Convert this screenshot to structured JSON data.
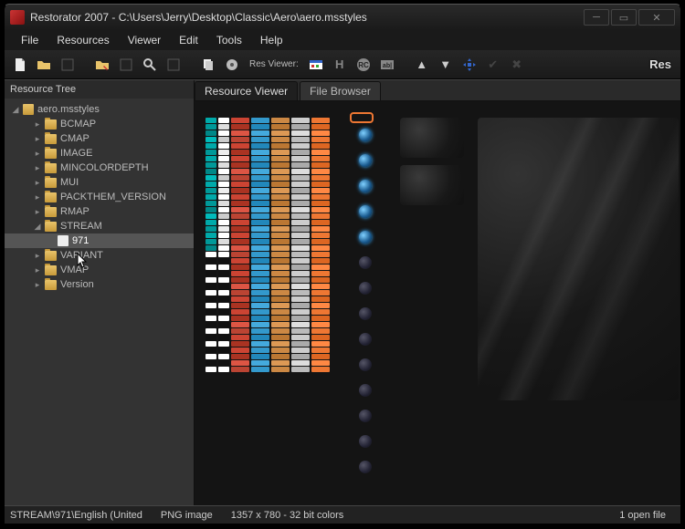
{
  "window": {
    "title": "Restorator 2007 - C:\\Users\\Jerry\\Desktop\\Classic\\Aero\\aero.msstyles"
  },
  "menu": [
    "File",
    "Resources",
    "Viewer",
    "Edit",
    "Tools",
    "Help"
  ],
  "toolbar": {
    "res_viewer_label": "Res Viewer:",
    "logo_top": "Res"
  },
  "sidebar": {
    "header": "Resource Tree",
    "root": "aero.msstyles",
    "items": [
      {
        "label": "BCMAP",
        "expandable": true
      },
      {
        "label": "CMAP",
        "expandable": true
      },
      {
        "label": "IMAGE",
        "expandable": true
      },
      {
        "label": "MINCOLORDEPTH",
        "expandable": true
      },
      {
        "label": "MUI",
        "expandable": true
      },
      {
        "label": "PACKTHEM_VERSION",
        "expandable": true
      },
      {
        "label": "RMAP",
        "expandable": true
      },
      {
        "label": "STREAM",
        "expandable": true,
        "expanded": true,
        "children": [
          {
            "label": "971",
            "selected": true
          }
        ]
      },
      {
        "label": "VARIANT",
        "expandable": true
      },
      {
        "label": "VMAP",
        "expandable": true
      },
      {
        "label": "Version",
        "expandable": true
      }
    ]
  },
  "tabs": [
    {
      "label": "Resource Viewer",
      "active": true
    },
    {
      "label": "File Browser",
      "active": false
    }
  ],
  "status": {
    "path": "STREAM\\971\\English (United",
    "type": "PNG image",
    "dims": "1357 x 780 - 32 bit colors",
    "files": "1 open file"
  }
}
